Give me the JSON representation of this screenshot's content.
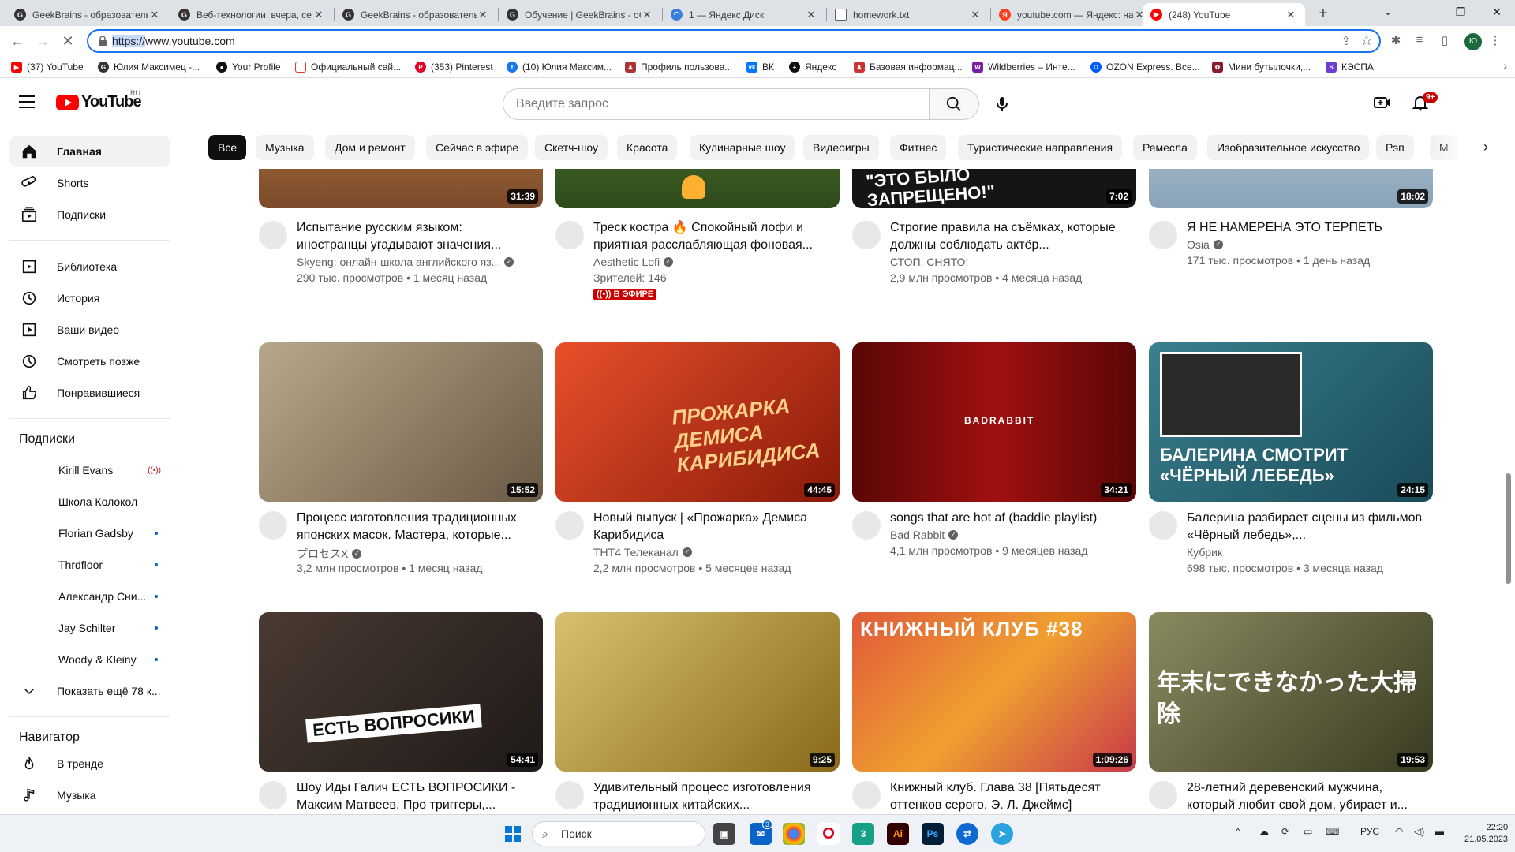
{
  "browser": {
    "tabs": [
      {
        "title": "GeekBrains - образовательный портал",
        "active": false
      },
      {
        "title": "Веб-технологии: вчера, сегодня, завтра",
        "active": false
      },
      {
        "title": "GeekBrains - образовательный портал",
        "active": false
      },
      {
        "title": "Обучение | GeekBrains - образовательный портал",
        "active": false
      },
      {
        "title": "1 — Яндекс Диск",
        "active": false
      },
      {
        "title": "homework.txt",
        "active": false
      },
      {
        "title": "youtube.com — Яндекс: нашлось",
        "active": false
      },
      {
        "title": "(248) YouTube",
        "active": true
      }
    ],
    "new_tab": "+",
    "window_controls": {
      "minimize": "—",
      "maximize": "❐",
      "close": "✕"
    },
    "address": {
      "scheme": "https://",
      "rest": "www.youtube.com"
    },
    "profile_initials": "Ю",
    "bookmarks": [
      "(37) YouTube",
      "Юлия Максимец -...",
      "Your Profile",
      "Официальный сай...",
      "(353) Pinterest",
      "(10) Юлия Максим...",
      "Профиль пользова...",
      "ВК",
      "Яндекс",
      "Базовая информац...",
      "Wildberries – Инте...",
      "OZON Express. Все...",
      "Мини бутылочки,...",
      "КЭСПА"
    ]
  },
  "youtube": {
    "logo_text": "YouTube",
    "logo_region": "RU",
    "search_placeholder": "Введите запрос",
    "notifications_count": "9+",
    "sidebar": {
      "main": [
        {
          "label": "Главная",
          "icon": "home-icon",
          "active": true
        },
        {
          "label": "Shorts",
          "icon": "shorts-icon"
        },
        {
          "label": "Подписки",
          "icon": "subscriptions-icon"
        }
      ],
      "library": [
        {
          "label": "Библиотека",
          "icon": "library-icon"
        },
        {
          "label": "История",
          "icon": "history-icon"
        },
        {
          "label": "Ваши видео",
          "icon": "your-videos-icon"
        },
        {
          "label": "Смотреть позже",
          "icon": "watch-later-icon"
        },
        {
          "label": "Понравившиеся",
          "icon": "liked-icon"
        }
      ],
      "subscriptions_heading": "Подписки",
      "subscriptions": [
        {
          "label": "Kirill Evans",
          "indicator": "live"
        },
        {
          "label": "Школа Колокол",
          "indicator": "none"
        },
        {
          "label": "Florian Gadsby",
          "indicator": "dot"
        },
        {
          "label": "Thrdfloor",
          "indicator": "dot"
        },
        {
          "label": "Александр Сни...",
          "indicator": "dot"
        },
        {
          "label": "Jay Schilter",
          "indicator": "dot"
        },
        {
          "label": "Woody & Kleiny",
          "indicator": "dot"
        }
      ],
      "show_more": "Показать ещё 78 к...",
      "navigator_heading": "Навигатор",
      "navigator": [
        {
          "label": "В тренде",
          "icon": "trending-icon"
        },
        {
          "label": "Музыка",
          "icon": "music-icon"
        }
      ]
    },
    "chips": [
      "Все",
      "Музыка",
      "Дом и ремонт",
      "Сейчас в эфире",
      "Скетч-шоу",
      "Красота",
      "Кулинарные шоу",
      "Видеоигры",
      "Фитнес",
      "Туристические направления",
      "Ремесла",
      "Изобразительное искусство",
      "Рэп",
      "М"
    ],
    "videos": [
      {
        "title": "Испытание русским языком: иностранцы угадывают значения...",
        "channel": "Skyeng: онлайн-школа английского яз...",
        "verified": true,
        "meta": "290 тыс. просмотров • 1 месяц назад",
        "duration": "31:39",
        "thumb_color": "#b56b3a",
        "thumb_text": ""
      },
      {
        "title": "Треск костра 🔥 Спокойный лофи и приятная расслабляющая фоновая...",
        "channel": "Aesthetic Lofi",
        "verified": true,
        "meta": "Зрителей: 146",
        "live": "В ЭФИРЕ",
        "duration": "",
        "thumb_color": "#3f6b2a",
        "thumb_text": ""
      },
      {
        "title": "Строгие правила на съёмках, которые должны соблюдать актёр...",
        "channel": "СТОП. СНЯТО!",
        "verified": false,
        "meta": "2,9 млн просмотров • 4 месяца назад",
        "duration": "7:02",
        "thumb_color": "#1a1a1a",
        "thumb_text": "\"ЭТО БЫЛО ЗАПРЕЩЕНО!\""
      },
      {
        "title": "Я НЕ НАМЕРЕНА ЭТО ТЕРПЕТЬ",
        "channel": "Osia",
        "verified": true,
        "meta": "171 тыс. просмотров • 1 день назад",
        "duration": "18:02",
        "thumb_color": "#9db6c9",
        "thumb_text": ""
      },
      {
        "title": "Процесс изготовления традиционных японских масок. Мастера, которые...",
        "channel": "プロセスX",
        "verified": true,
        "meta": "3,2 млн просмотров • 1 месяц назад",
        "duration": "15:52",
        "thumb_color": "#8b7a62",
        "thumb_text": ""
      },
      {
        "title": "Новый выпуск | «Прожарка» Демиса Карибидиса",
        "channel": "ТНТ4 Телеканал",
        "verified": true,
        "meta": "2,2 млн просмотров • 5 месяцев назад",
        "duration": "44:45",
        "thumb_color": "#c8321a",
        "thumb_text": "ПРОЖАРКА ДЕМИСА КАРИБИДИСА"
      },
      {
        "title": "songs that are hot af (baddie playlist)",
        "channel": "Bad Rabbit",
        "verified": true,
        "meta": "4,1 млн просмотров • 9 месяцев назад",
        "duration": "34:21",
        "thumb_color": "#7a0a0a",
        "thumb_text": "BADRABBIT"
      },
      {
        "title": "Балерина разбирает сцены из фильмов «Чёрный лебедь»,...",
        "channel": "Кубрик",
        "verified": false,
        "meta": "698 тыс. просмотров • 3 месяца назад",
        "duration": "24:15",
        "thumb_color": "#2a6a78",
        "thumb_text": "БАЛЕРИНА СМОТРИТ «ЧЁРНЫЙ ЛЕБЕДЬ»"
      },
      {
        "title": "Шоу Иды Галич ЕСТЬ ВОПРОСИКИ - Максим Матвеев. Про триггеры,...",
        "channel": "",
        "verified": false,
        "meta": "",
        "duration": "54:41",
        "thumb_color": "#3a2e2a",
        "thumb_text": "ЕСТЬ ВОПРОСИКИ"
      },
      {
        "title": "Удивительный процесс изготовления традиционных китайских...",
        "channel": "",
        "verified": false,
        "meta": "",
        "duration": "9:25",
        "thumb_color": "#b89a3a",
        "thumb_text": ""
      },
      {
        "title": "Книжный клуб. Глава 38 [Пятьдесят оттенков серого. Э. Л. Джеймс]",
        "channel": "",
        "verified": false,
        "meta": "",
        "duration": "1:09:26",
        "thumb_color": "#c84a3a",
        "thumb_text": "КНИЖНЫЙ КЛУБ #38"
      },
      {
        "title": "28-летний деревенский мужчина, который любит свой дом, убирает и...",
        "channel": "",
        "verified": false,
        "meta": "",
        "duration": "19:53",
        "thumb_color": "#6b6a48",
        "thumb_text": "年末にできなかった大掃除"
      }
    ]
  },
  "taskbar": {
    "search_label": "Поиск",
    "mail_badge": "3",
    "lang": "РУС",
    "time": "22:20",
    "date": "21.05.2023"
  }
}
